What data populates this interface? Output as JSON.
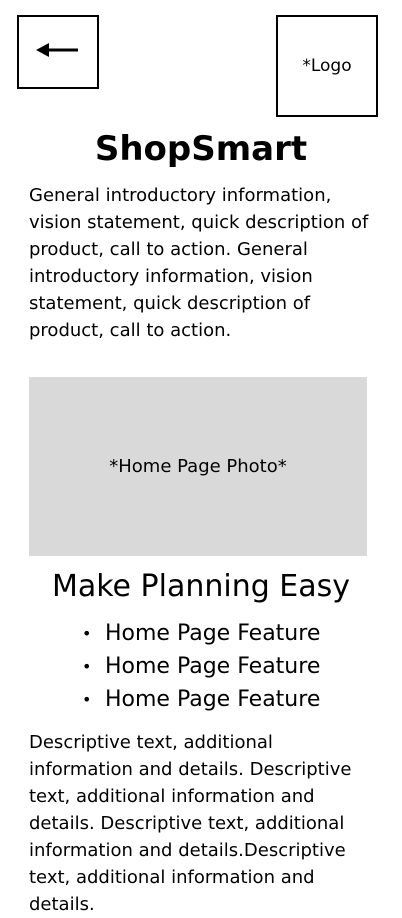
{
  "header": {
    "back_icon": "arrow-left-icon",
    "logo_label": "*Logo"
  },
  "hero": {
    "title": "ShopSmart",
    "intro": "General introductory information, vision statement, quick description of product, call to action. General introductory information, vision statement, quick description of product, call to action."
  },
  "photo": {
    "label": "*Home Page Photo*"
  },
  "planning": {
    "title": "Make Planning Easy",
    "features": [
      "Home Page Feature",
      "Home Page Feature",
      "Home Page Feature"
    ],
    "description": "Descriptive text, additional information and details. Descriptive text, additional information and details. Descriptive text, additional information and details.Descriptive text, additional information and details."
  },
  "colors": {
    "photo_placeholder": "#d9d9d9",
    "border": "#000000"
  }
}
